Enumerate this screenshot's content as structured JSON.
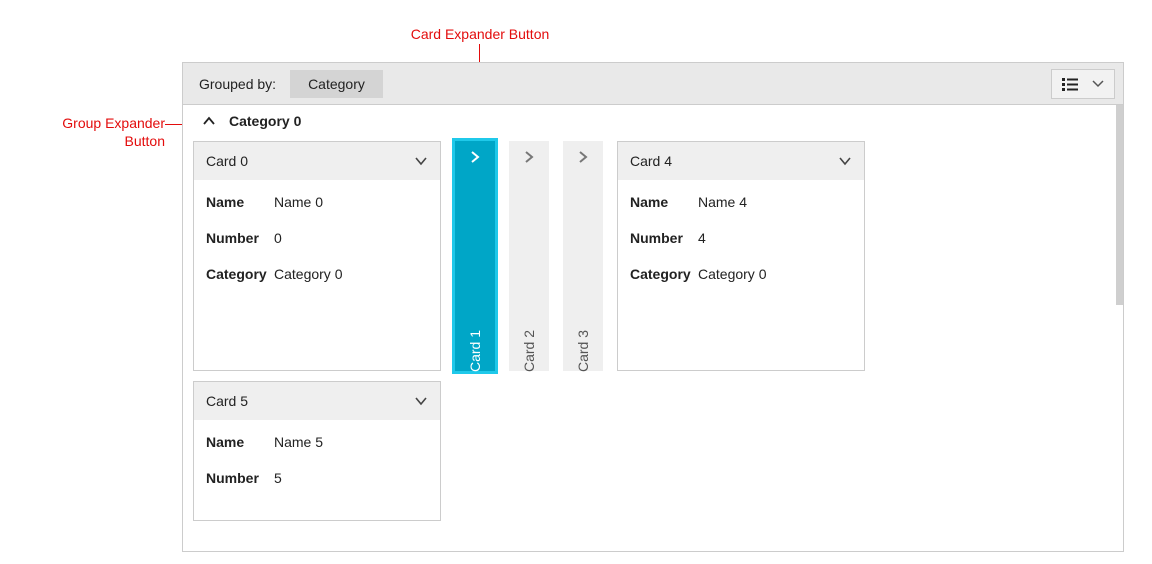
{
  "annotations": {
    "card_expander": "Card Expander Button",
    "group_expander_l1": "Group Expander",
    "group_expander_l2": "Button"
  },
  "toolbar": {
    "grouped_by_label": "Grouped by:",
    "group_field": "Category"
  },
  "group": {
    "title": "Category 0"
  },
  "cards": {
    "c0": {
      "title": "Card 0",
      "fields": {
        "name_label": "Name",
        "name_value": "Name 0",
        "number_label": "Number",
        "number_value": "0",
        "category_label": "Category",
        "category_value": "Category 0"
      }
    },
    "c1": {
      "title": "Card 1"
    },
    "c2": {
      "title": "Card 2"
    },
    "c3": {
      "title": "Card 3"
    },
    "c4": {
      "title": "Card 4",
      "fields": {
        "name_label": "Name",
        "name_value": "Name 4",
        "number_label": "Number",
        "number_value": "4",
        "category_label": "Category",
        "category_value": "Category 0"
      }
    },
    "c5": {
      "title": "Card 5",
      "fields": {
        "name_label": "Name",
        "name_value": "Name 5",
        "number_label": "Number",
        "number_value": "5"
      }
    }
  },
  "colors": {
    "annotation": "#e30c0c",
    "selected_bg": "#00a6c7",
    "selected_outline": "#1fc9ea"
  }
}
